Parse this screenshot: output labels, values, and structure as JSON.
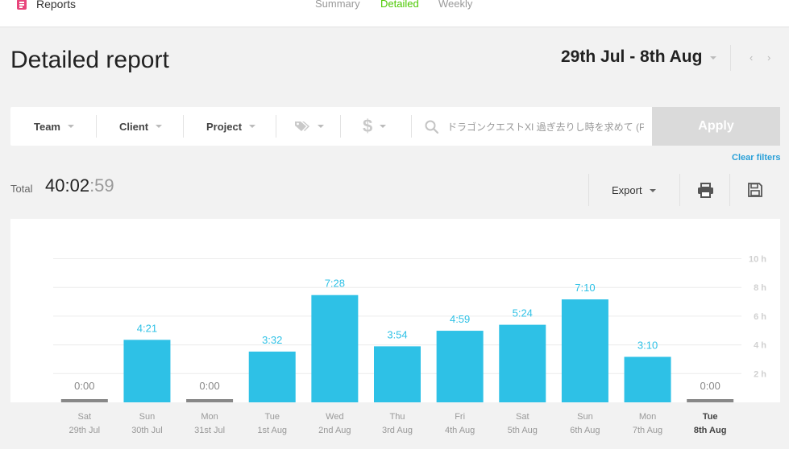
{
  "app": {
    "title": "Reports"
  },
  "tabs": [
    {
      "label": "Summary",
      "active": false
    },
    {
      "label": "Detailed",
      "active": true
    },
    {
      "label": "Weekly",
      "active": false
    }
  ],
  "header": {
    "title": "Detailed report",
    "date_range": "29th Jul - 8th Aug",
    "prev_icon": "chevron-left-icon",
    "next_icon": "chevron-right-icon"
  },
  "filters": {
    "team": "Team",
    "client": "Client",
    "project": "Project",
    "tags_icon": "tags-icon",
    "billable_icon": "dollar-icon",
    "search_icon": "search-icon",
    "search_value": "ドラゴンクエストXI 過ぎ去りし時を求めて (P",
    "apply": "Apply",
    "clear": "Clear filters"
  },
  "total": {
    "label": "Total",
    "hours": "40:02",
    "seconds": ":59"
  },
  "toolbar": {
    "export": "Export",
    "print_icon": "print-icon",
    "save_icon": "save-icon"
  },
  "colors": {
    "bar": "#2ec1e6",
    "bar_zero": "#888888",
    "active_tab": "#4bc800",
    "link": "#2aa0d8"
  },
  "chart_data": {
    "type": "bar",
    "categories": [
      {
        "day": "Sat",
        "date": "29th Jul"
      },
      {
        "day": "Sun",
        "date": "30th Jul"
      },
      {
        "day": "Mon",
        "date": "31st Jul"
      },
      {
        "day": "Tue",
        "date": "1st Aug"
      },
      {
        "day": "Wed",
        "date": "2nd Aug"
      },
      {
        "day": "Thu",
        "date": "3rd Aug"
      },
      {
        "day": "Fri",
        "date": "4th Aug"
      },
      {
        "day": "Sat",
        "date": "5th Aug"
      },
      {
        "day": "Sun",
        "date": "6th Aug"
      },
      {
        "day": "Mon",
        "date": "7th Aug"
      },
      {
        "day": "Tue",
        "date": "8th Aug",
        "current": true
      }
    ],
    "values": [
      0,
      4.35,
      0,
      3.533,
      7.467,
      3.9,
      4.983,
      5.4,
      7.167,
      3.167,
      0
    ],
    "labels": [
      "0:00",
      "4:21",
      "0:00",
      "3:32",
      "7:28",
      "3:54",
      "4:59",
      "5:24",
      "7:10",
      "3:10",
      "0:00"
    ],
    "yticks": [
      {
        "value": 10,
        "label": "10 h"
      },
      {
        "value": 8,
        "label": "8 h"
      },
      {
        "value": 6,
        "label": "6 h"
      },
      {
        "value": 4,
        "label": "4 h"
      },
      {
        "value": 2,
        "label": "2 h"
      }
    ],
    "ylim": [
      0,
      10
    ],
    "grid": true
  }
}
